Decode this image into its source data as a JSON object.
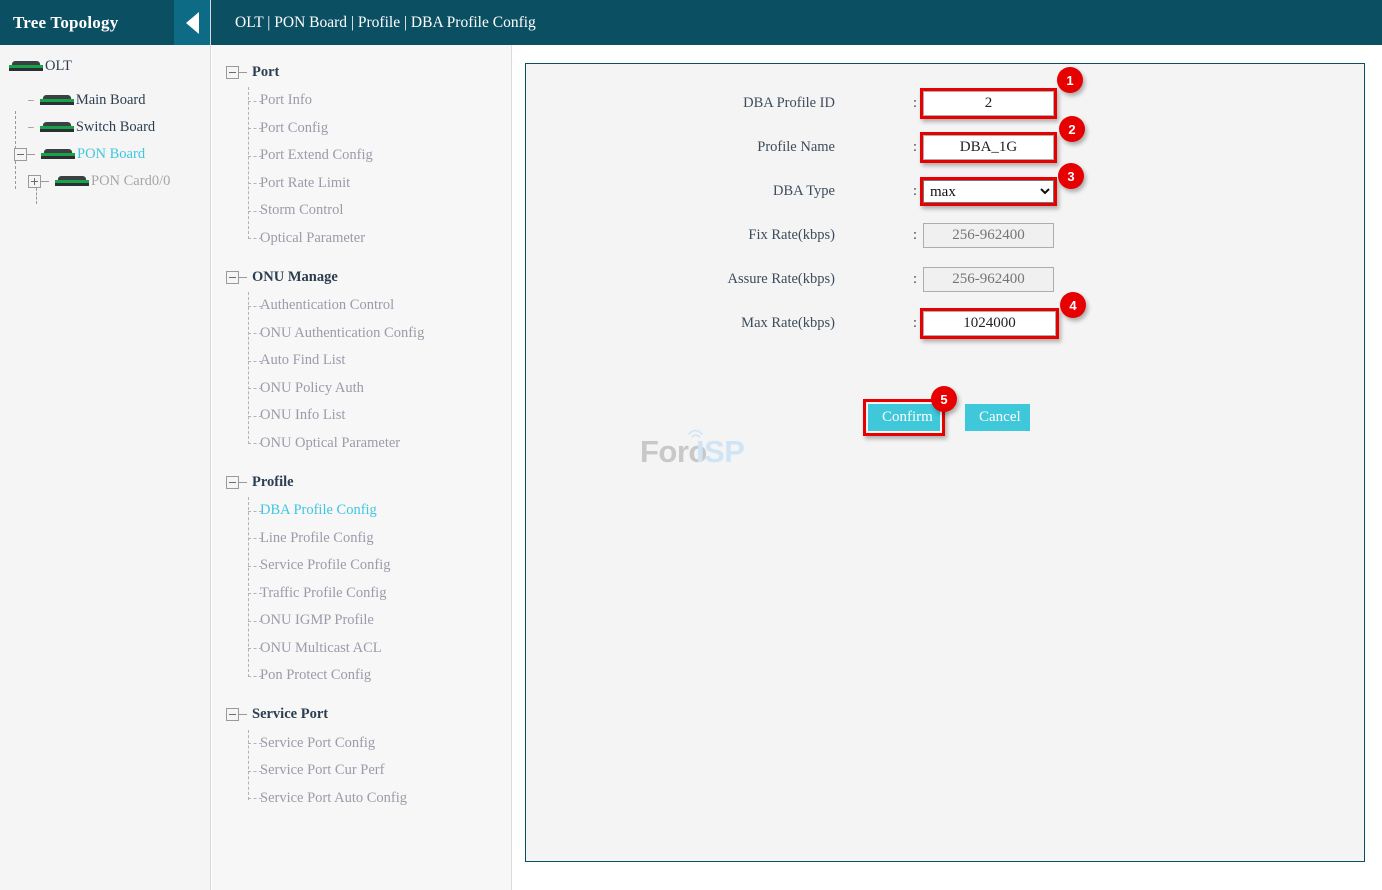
{
  "sidebar": {
    "title": "Tree Topology",
    "collapse_icon": "left-triangle-icon",
    "tree": [
      {
        "label": "OLT",
        "state": "normal",
        "expander": null,
        "icon": "board-icon",
        "depth": 0
      },
      {
        "label": "Main Board",
        "state": "normal",
        "expander": null,
        "icon": "board-icon",
        "depth": 1
      },
      {
        "label": "Switch Board",
        "state": "normal",
        "expander": null,
        "icon": "board-icon",
        "depth": 1
      },
      {
        "label": "PON Board",
        "state": "cyan",
        "expander": "minus",
        "icon": "board-icon",
        "depth": 1
      },
      {
        "label": "PON Card0/0",
        "state": "muted",
        "expander": "plus",
        "icon": "board-icon",
        "depth": 2
      }
    ]
  },
  "topbar": {
    "breadcrumb": "OLT | PON Board | Profile | DBA Profile Config"
  },
  "menu": {
    "groups": [
      {
        "label": "Port",
        "expander": "minus",
        "items": [
          {
            "label": "Port Info",
            "active": false
          },
          {
            "label": "Port Config",
            "active": false
          },
          {
            "label": "Port Extend Config",
            "active": false
          },
          {
            "label": "Port Rate Limit",
            "active": false
          },
          {
            "label": "Storm Control",
            "active": false
          },
          {
            "label": "Optical Parameter",
            "active": false
          }
        ]
      },
      {
        "label": "ONU Manage",
        "expander": "minus",
        "items": [
          {
            "label": "Authentication Control",
            "active": false
          },
          {
            "label": "ONU Authentication Config",
            "active": false
          },
          {
            "label": "Auto Find List",
            "active": false
          },
          {
            "label": "ONU Policy Auth",
            "active": false
          },
          {
            "label": "ONU Info List",
            "active": false
          },
          {
            "label": "ONU Optical Parameter",
            "active": false
          }
        ]
      },
      {
        "label": "Profile",
        "expander": "minus",
        "items": [
          {
            "label": "DBA Profile Config",
            "active": true
          },
          {
            "label": "Line Profile Config",
            "active": false
          },
          {
            "label": "Service Profile Config",
            "active": false
          },
          {
            "label": "Traffic Profile Config",
            "active": false
          },
          {
            "label": "ONU IGMP Profile",
            "active": false
          },
          {
            "label": "ONU Multicast ACL",
            "active": false
          },
          {
            "label": "Pon Protect Config",
            "active": false
          }
        ]
      },
      {
        "label": "Service Port",
        "expander": "minus",
        "items": [
          {
            "label": "Service Port Config",
            "active": false
          },
          {
            "label": "Service Port Cur Perf",
            "active": false
          },
          {
            "label": "Service Port Auto Config",
            "active": false
          }
        ]
      }
    ]
  },
  "form": {
    "fields": [
      {
        "label": "DBA Profile ID",
        "colon": ":",
        "value": "2",
        "placeholder": "",
        "type": "text",
        "disabled": false,
        "highlight": true,
        "badge": "1"
      },
      {
        "label": "Profile Name",
        "colon": ":",
        "value": "DBA_1G",
        "placeholder": "",
        "type": "text",
        "disabled": false,
        "highlight": true,
        "badge": "2"
      },
      {
        "label": "DBA Type",
        "colon": ":",
        "value": "max",
        "placeholder": "",
        "type": "select",
        "disabled": false,
        "highlight": true,
        "badge": "3",
        "options": [
          "max"
        ]
      },
      {
        "label": "Fix Rate(kbps)",
        "colon": ":",
        "value": "",
        "placeholder": "256-962400",
        "type": "text",
        "disabled": true,
        "highlight": false,
        "badge": ""
      },
      {
        "label": "Assure Rate(kbps)",
        "colon": ":",
        "value": "",
        "placeholder": "256-962400",
        "type": "text",
        "disabled": true,
        "highlight": false,
        "badge": ""
      },
      {
        "label": "Max Rate(kbps)",
        "colon": ":",
        "value": "1024000",
        "placeholder": "",
        "type": "text",
        "disabled": false,
        "highlight": true,
        "badge": "4"
      }
    ],
    "confirm_label": "Confirm",
    "cancel_label": "Cancel",
    "confirm_badge": "5"
  },
  "watermark": {
    "part1": "Foro",
    "part2": "ISP"
  },
  "colors": {
    "header_teal": "#0b4f63",
    "accent_cyan": "#3fc7da",
    "badge_red": "#e60000",
    "highlight_red": "#e60000",
    "panel_bg": "#f4f4f4"
  }
}
